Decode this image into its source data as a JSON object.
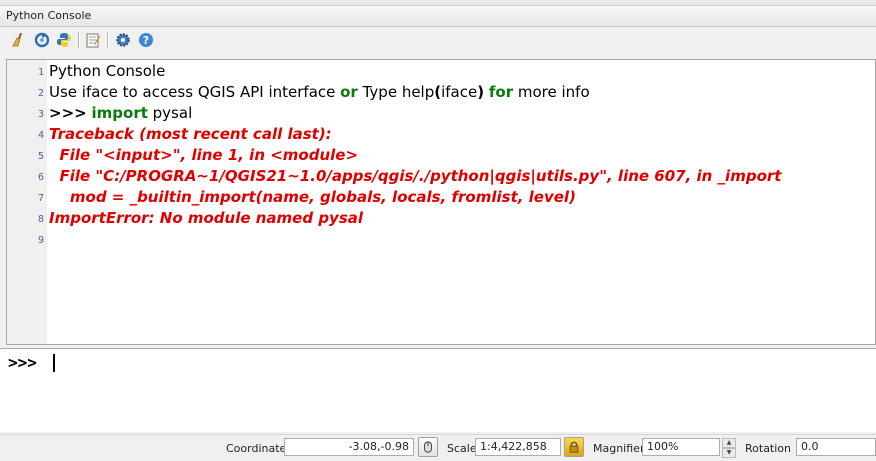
{
  "panel": {
    "title": "Python Console"
  },
  "toolbar": {
    "icons": [
      "clear-console-icon",
      "reload-icon",
      "python-icon",
      "editor-icon",
      "settings-icon",
      "help-icon"
    ]
  },
  "console": {
    "lines": [
      {
        "n": "1",
        "parts": [
          {
            "t": "Python Console",
            "s": "plain"
          }
        ]
      },
      {
        "n": "2",
        "parts": [
          {
            "t": "Use iface to access QGIS API interface ",
            "s": "plain"
          },
          {
            "t": "or",
            "s": "kw"
          },
          {
            "t": " Type help",
            "s": "plain"
          },
          {
            "t": "(",
            "s": "bold"
          },
          {
            "t": "iface",
            "s": "plain"
          },
          {
            "t": ")",
            "s": "bold"
          },
          {
            "t": " ",
            "s": "plain"
          },
          {
            "t": "for",
            "s": "kw"
          },
          {
            "t": " more info",
            "s": "plain"
          }
        ]
      },
      {
        "n": "3",
        "parts": [
          {
            "t": ">>>",
            "s": "bold"
          },
          {
            "t": " ",
            "s": "plain"
          },
          {
            "t": "import",
            "s": "kw"
          },
          {
            "t": " pysal",
            "s": "plain"
          }
        ]
      },
      {
        "n": "4",
        "parts": [
          {
            "t": "Traceback (most recent call last):",
            "s": "err"
          }
        ]
      },
      {
        "n": "5",
        "parts": [
          {
            "t": "  File \"<input>\", line 1, in <module>",
            "s": "err"
          }
        ]
      },
      {
        "n": "6",
        "parts": [
          {
            "t": "  File \"C:/PROGRA~1/QGIS21~1.0/apps/qgis/./python|qgis|utils.py\", line 607, in _import",
            "s": "err"
          }
        ]
      },
      {
        "n": "7",
        "parts": [
          {
            "t": "    mod = _builtin_import(name, globals, locals, fromlist, level)",
            "s": "err"
          }
        ]
      },
      {
        "n": "8",
        "parts": [
          {
            "t": "ImportError: No module named pysal",
            "s": "err"
          }
        ]
      },
      {
        "n": "9",
        "parts": []
      }
    ],
    "prompt": ">>>"
  },
  "status": {
    "coordinate_label": "Coordinate",
    "coordinate_value": "-3.08,-0.98",
    "scale_label": "Scale",
    "scale_value": "1:4,422,858",
    "magnifier_label": "Magnifier",
    "magnifier_value": "100%",
    "rotation_label": "Rotation",
    "rotation_value": "0.0"
  },
  "colors": {
    "keyword": "#0a7a0a",
    "error": "#e00000",
    "line_number": "#5b5b9b"
  }
}
